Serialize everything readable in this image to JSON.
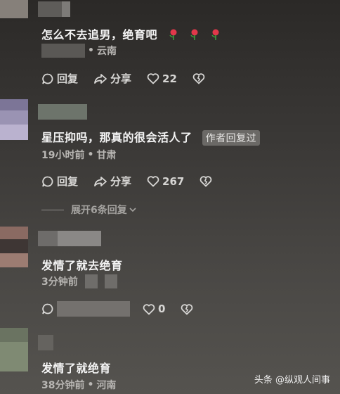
{
  "comments": [
    {
      "text": "怎么不去追男，绝育吧",
      "location": "云南",
      "actions": {
        "reply": "回复",
        "share": "分享",
        "likes": "22"
      }
    },
    {
      "text": "星压抑吗，那真的很会活人了",
      "author_tag": "作者回复过",
      "time": "19小时前",
      "location": "甘肃",
      "actions": {
        "reply": "回复",
        "share": "分享",
        "likes": "267"
      },
      "expand_label": "展开6条回复"
    },
    {
      "text": "发情了就去绝育",
      "time": "3分钟前",
      "actions": {
        "likes": "0"
      }
    },
    {
      "text": "发情了就绝育",
      "time": "38分钟前",
      "location": "河南"
    }
  ],
  "watermark": "头条 @纵观人间事",
  "colors": {
    "like": "#d7d6d4",
    "tag_bg": "#6b6966",
    "rose": "#e0384a"
  }
}
